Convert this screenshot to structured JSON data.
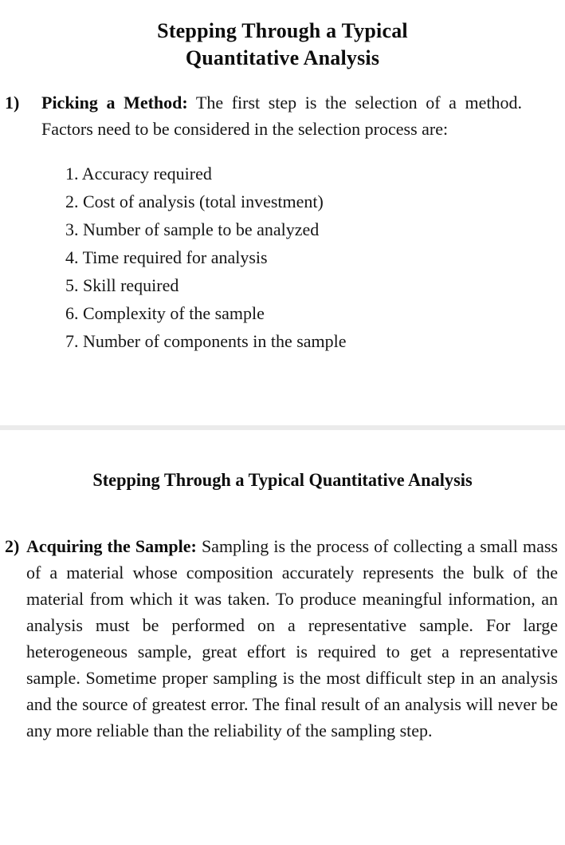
{
  "document": {
    "background_color": "#ffffff",
    "text_color": "#151515",
    "divider_color": "#ebebeb"
  },
  "section_one": {
    "title_line_1": "Stepping Through a Typical",
    "title_line_2": "Quantitative Analysis",
    "item": {
      "marker": "1)",
      "lead": "Picking a Method:",
      "text": " The first step is the selection of a method. Factors need to be considered in the selection process are:"
    },
    "sub_list": [
      "1. Accuracy required",
      "2. Cost of analysis (total investment)",
      "3. Number of sample to be analyzed",
      "4. Time required for analysis",
      "5. Skill required",
      "6. Complexity of the sample",
      "7. Number of components in the sample"
    ]
  },
  "section_two": {
    "title": "Stepping Through a Typical Quantitative Analysis",
    "item": {
      "marker": "2)",
      "lead": "Acquiring the Sample:",
      "text": " Sampling is the process of collecting a small mass of a material whose composition accurately represents the bulk of the material from which it was taken. To produce meaningful information, an analysis must be performed on a representative sample. For large heterogeneous sample, great effort is required to get a representative sample. Sometime proper sampling is the most difficult step in an analysis and the source of greatest error. The final result of an analysis will never be any more reliable than the reliability of the sampling step."
    }
  }
}
